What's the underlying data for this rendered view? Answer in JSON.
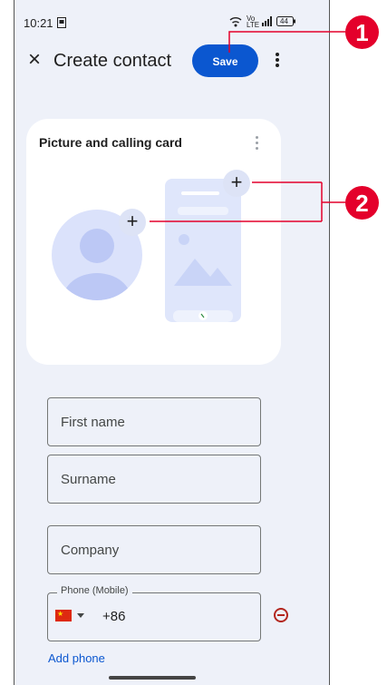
{
  "status_bar": {
    "time": "10:21",
    "network": "Vo LTE",
    "battery": "44"
  },
  "toolbar": {
    "close_label": "×",
    "title": "Create contact",
    "save_label": "Save"
  },
  "card": {
    "title": "Picture and calling card",
    "add_label": "+"
  },
  "form": {
    "first_name_label": "First name",
    "surname_label": "Surname",
    "company_label": "Company",
    "phone_label": "Phone (Mobile)",
    "country_code": "+86",
    "flag_star": "★",
    "add_phone_label": "Add phone"
  },
  "callouts": [
    "1",
    "2"
  ],
  "colors": {
    "accent": "#0b57d0",
    "background": "#eef1f9",
    "callout": "#e4002b",
    "remove": "#b3261e"
  }
}
